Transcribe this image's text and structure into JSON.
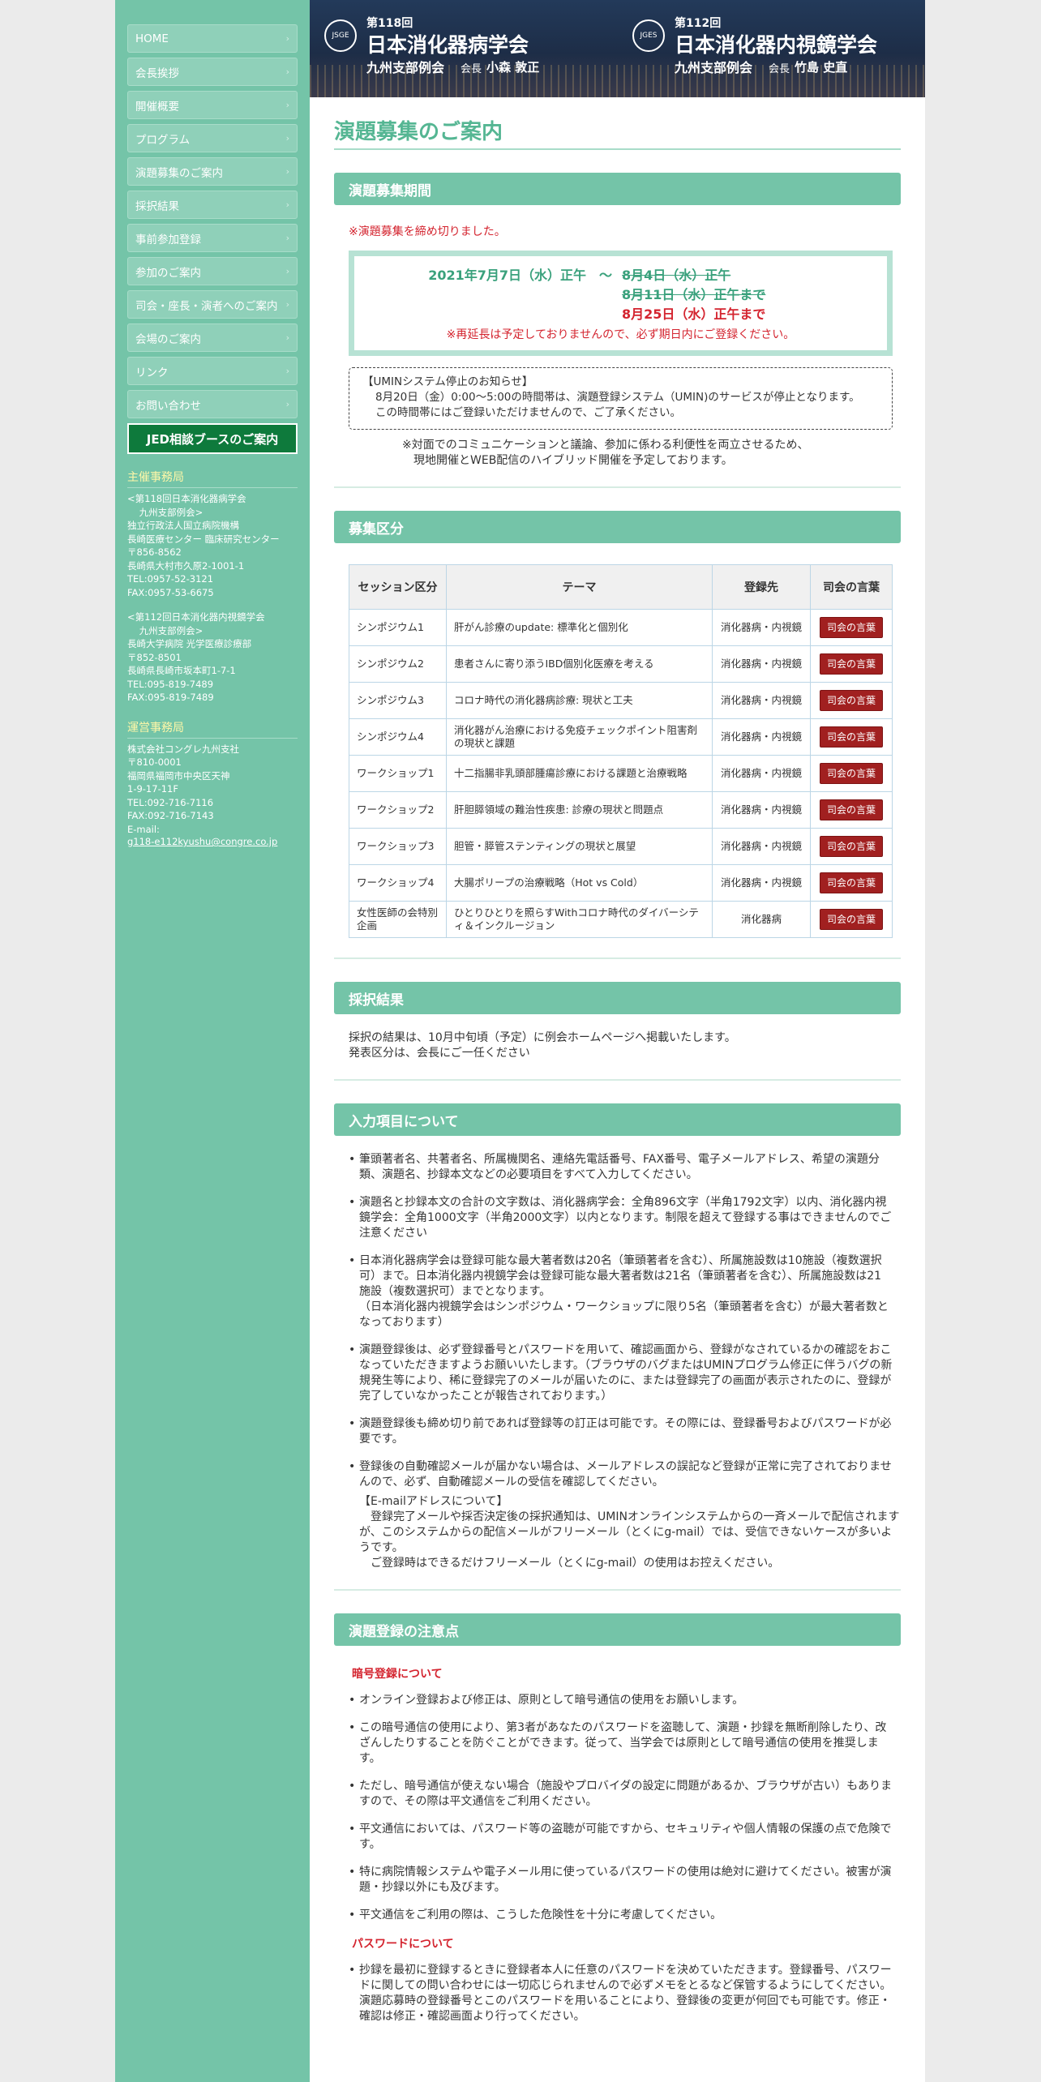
{
  "nav": [
    "HOME",
    "会長挨拶",
    "開催概要",
    "プログラム",
    "演題募集のご案内",
    "採択結果",
    "事前参加登録",
    "参加のご案内",
    "司会・座長・演者へのご案内",
    "会場のご案内",
    "リンク",
    "お問い合わせ"
  ],
  "jed_button": "JED相談ブースのご案内",
  "host": {
    "heading": "主催事務局",
    "block1": "<第118回日本消化器病学会\n    九州支部例会>\n独立行政法人国立病院機構\n長崎医療センター 臨床研究センター\n〒856-8562\n長崎県大村市久原2-1001-1\nTEL:0957-52-3121\nFAX:0957-53-6675",
    "block2": "<第112回日本消化器内視鏡学会\n    九州支部例会>\n長崎大学病院 光学医療診療部\n〒852-8501\n長崎県長崎市坂本町1-7-1\nTEL:095-819-7489\nFAX:095-819-7489"
  },
  "ops": {
    "heading": "運営事務局",
    "block": "株式会社コングレ九州支社\n〒810-0001\n福岡県福岡市中央区天神\n1-9-17-11F\nTEL:092-716-7116\nFAX:092-716-7143\nE-mail:",
    "email": "g118-e112kyushu@congre.co.jp"
  },
  "banner": {
    "soc1": {
      "session": "第118回",
      "name": "日本消化器病学会",
      "branch": "九州支部例会",
      "pres_label": "会長",
      "pres_name": "小森 敦正",
      "logo": "JSGE"
    },
    "soc2": {
      "session": "第112回",
      "name": "日本消化器内視鏡学会",
      "branch": "九州支部例会",
      "pres_label": "会長",
      "pres_name": "竹島 史直",
      "logo": "JGES"
    }
  },
  "page_title": "演題募集のご案内",
  "period": {
    "title": "演題募集期間",
    "closed": "※演題募集を締め切りました。",
    "start": "2021年7月7日（水）正午　～",
    "end1": "8月4日（水）正午",
    "end2": "8月11日（水）正午まで",
    "end3": "8月25日（水）正午まで",
    "note": "※再延長は予定しておりませんので、必ず期日内にご登録ください。",
    "umin_title": "【UMINシステム停止のお知らせ】",
    "umin_body": "8月20日（金）0:00～5:00の時間帯は、演題登録システム（UMIN)のサービスが停止となります。\nこの時間帯にはご登録いただけませんので、ご了承ください。",
    "hybrid": "※対面でのコミュニケーションと議論、参加に係わる利便性を両立させるため、\n　現地開催とWEB配信のハイブリッド開催を予定しております。"
  },
  "category": {
    "title": "募集区分",
    "headers": [
      "セッション区分",
      "テーマ",
      "登録先",
      "司会の言葉"
    ],
    "button_label": "司会の言葉",
    "rows": [
      [
        "シンポジウム1",
        "肝がん診療のupdate: 標準化と個別化",
        "消化器病・内視鏡"
      ],
      [
        "シンポジウム2",
        "患者さんに寄り添うIBD個別化医療を考える",
        "消化器病・内視鏡"
      ],
      [
        "シンポジウム3",
        "コロナ時代の消化器病診療: 現状と工夫",
        "消化器病・内視鏡"
      ],
      [
        "シンポジウム4",
        "消化器がん治療における免疫チェックポイント阻害剤の現状と課題",
        "消化器病・内視鏡"
      ],
      [
        "ワークショップ1",
        "十二指腸非乳頭部腫瘍診療における課題と治療戦略",
        "消化器病・内視鏡"
      ],
      [
        "ワークショップ2",
        "肝胆膵領域の難治性疾患: 診療の現状と問題点",
        "消化器病・内視鏡"
      ],
      [
        "ワークショップ3",
        "胆管・膵管ステンティングの現状と展望",
        "消化器病・内視鏡"
      ],
      [
        "ワークショップ4",
        "大腸ポリープの治療戦略（Hot vs Cold）",
        "消化器病・内視鏡"
      ],
      [
        "女性医師の会特別企画",
        "ひとりひとりを照らすWithコロナ時代のダイバーシティ＆インクルージョン",
        "消化器病"
      ]
    ]
  },
  "result": {
    "title": "採択結果",
    "text": "採択の結果は、10月中旬頃（予定）に例会ホームページへ掲載いたします。\n発表区分は、会長にご一任ください"
  },
  "input": {
    "title": "入力項目について",
    "items": [
      "筆頭著者名、共著者名、所属機関名、連絡先電話番号、FAX番号、電子メールアドレス、希望の演題分類、演題名、抄録本文などの必要項目をすべて入力してください。",
      "演題名と抄録本文の合計の文字数は、消化器病学会：全角896文字（半角1792文字）以内、消化器内視鏡学会：全角1000文字（半角2000文字）以内となります。制限を超えて登録する事はできませんのでご注意ください",
      "日本消化器病学会は登録可能な最大著者数は20名（筆頭著者を含む）、所属施設数は10施設（複数選択可）まで。日本消化器内視鏡学会は登録可能な最大著者数は21名（筆頭著者を含む）、所属施設数は21施設（複数選択可）までとなります。\n（日本消化器内視鏡学会はシンポジウム・ワークショップに限り5名（筆頭著者を含む）が最大著者数となっております）",
      "演題登録後は、必ず登録番号とパスワードを用いて、確認画面から、登録がなされているかの確認をおこなっていただきますようお願いいたします。（ブラウザのバグまたはUMINプログラム修正に伴うバグの新規発生等により、稀に登録完了のメールが届いたのに、または登録完了の画面が表示されたのに、登録が完了していなかったことが報告されております。）",
      "演題登録後も締め切り前であれば登録等の訂正は可能です。その際には、登録番号およびパスワードが必要です。",
      "登録後の自動確認メールが届かない場合は、メールアドレスの誤記など登録が正常に完了されておりませんので、必ず、自動確認メールの受信を確認してください。"
    ],
    "email_note": "【E-mailアドレスについて】\n　登録完了メールや採否決定後の採択通知は、UMINオンラインシステムからの一斉メールで配信されますが、このシステムからの配信メールがフリーメール（とくにg-mail）では、受信できないケースが多いようです。\n　ご登録時はできるだけフリーメール（とくにg-mail）の使用はお控えください。"
  },
  "notes": {
    "title": "演題登録の注意点",
    "sub1": "暗号登録について",
    "items1": [
      "オンライン登録および修正は、原則として暗号通信の使用をお願いします。",
      "この暗号通信の使用により、第3者があなたのパスワードを盗聴して、演題・抄録を無断削除したり、改ざんしたりすることを防ぐことができます。従って、当学会では原則として暗号通信の使用を推奨します。",
      "ただし、暗号通信が使えない場合（施設やプロバイダの設定に問題があるか、ブラウザが古い）もありますので、その際は平文通信をご利用ください。",
      "平文通信においては、パスワード等の盗聴が可能ですから、セキュリティや個人情報の保護の点で危険です。",
      "特に病院情報システムや電子メール用に使っているパスワードの使用は絶対に避けてください。被害が演題・抄録以外にも及びます。",
      "平文通信をご利用の際は、こうした危険性を十分に考慮してください。"
    ],
    "sub2": "パスワードについて",
    "items2": [
      "抄録を最初に登録するときに登録者本人に任意のパスワードを決めていただきます。登録番号、パスワードに関しての問い合わせには一切応じられませんので必ずメモをとるなど保管するようにしてください。演題応募時の登録番号とこのパスワードを用いることにより、登録後の変更が何回でも可能です。修正・確認は修正・確認画面より行ってください。"
    ]
  }
}
